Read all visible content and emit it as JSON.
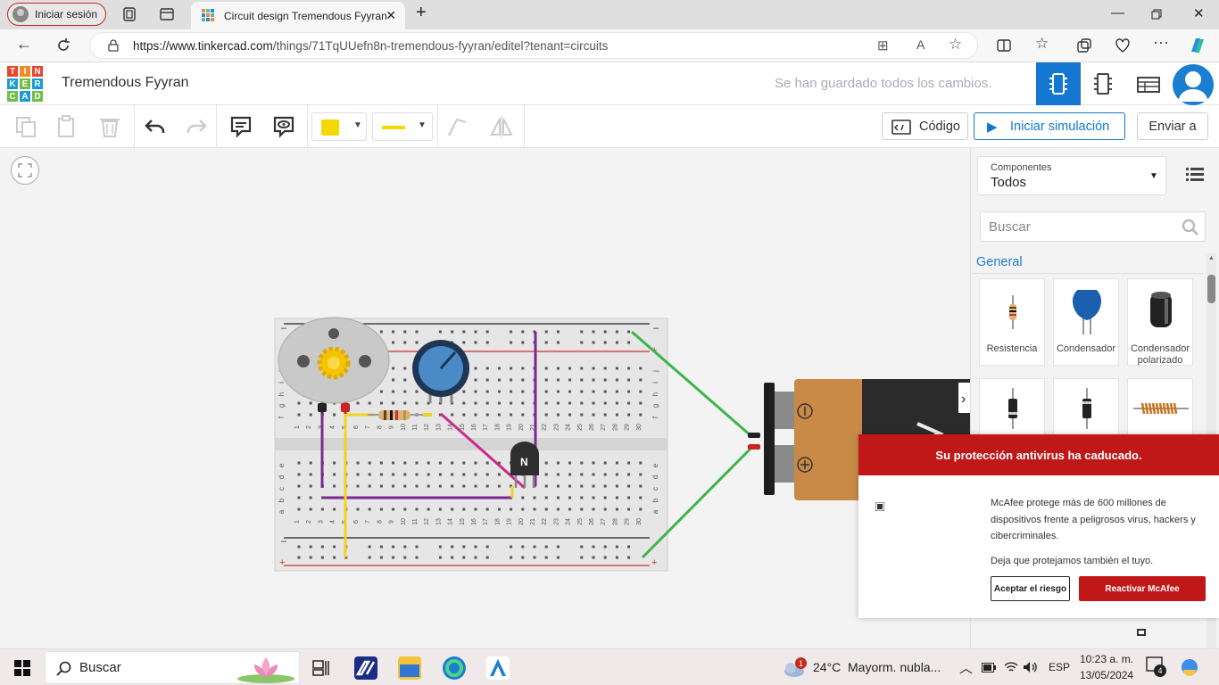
{
  "browser": {
    "signin_label": "Iniciar sesión",
    "tab_title": "Circuit design Tremendous Fyyran",
    "url_host": "https://www.tinkercad.com",
    "url_path": "/things/71TqUUefn8n-tremendous-fyyran/editel?tenant=circuits"
  },
  "app": {
    "logo_letters": [
      "T",
      "I",
      "N",
      "K",
      "E",
      "R",
      "C",
      "A",
      "D"
    ],
    "project_name": "Tremendous Fyyran",
    "save_status": "Se han guardado todos los cambios.",
    "code_button": "Código",
    "simulate_button": "Iniciar simulación",
    "send_button": "Enviar a"
  },
  "panel": {
    "components_label": "Componentes",
    "components_value": "Todos",
    "search_placeholder": "Buscar",
    "section_general": "General",
    "items": [
      {
        "label": "Resistencia"
      },
      {
        "label": "Condensador"
      },
      {
        "label": "Condensador polarizado"
      }
    ]
  },
  "breadboard": {
    "top_row_letters": [
      "j",
      "i",
      "h",
      "g",
      "f"
    ],
    "bottom_row_letters": [
      "e",
      "d",
      "c",
      "b",
      "a"
    ],
    "transistor_label": "N"
  },
  "popup": {
    "title": "Su protección antivirus ha caducado.",
    "body1": "McAfee protege más de 600 millones de dispositivos frente a peligrosos virus, hackers y cibercriminales.",
    "body2": "Deja que protejamos también el tuyo.",
    "accept_button": "Aceptar el riesgo",
    "reactivate_button": "Reactivar McAfee"
  },
  "taskbar": {
    "search_label": "Buscar",
    "weather_temp": "24°C",
    "weather_desc": "Mayorm. nubla...",
    "weather_badge": "1",
    "language": "ESP",
    "time": "10:23 a. m.",
    "date": "13/05/2024",
    "notif_count": "4"
  },
  "colors": {
    "accent": "#1477d1",
    "danger": "#c01818",
    "wire_purple": "#7b2a8f",
    "wire_yellow": "#f2d21b",
    "wire_green": "#3db54a",
    "wire_magenta": "#cc2a8a"
  }
}
